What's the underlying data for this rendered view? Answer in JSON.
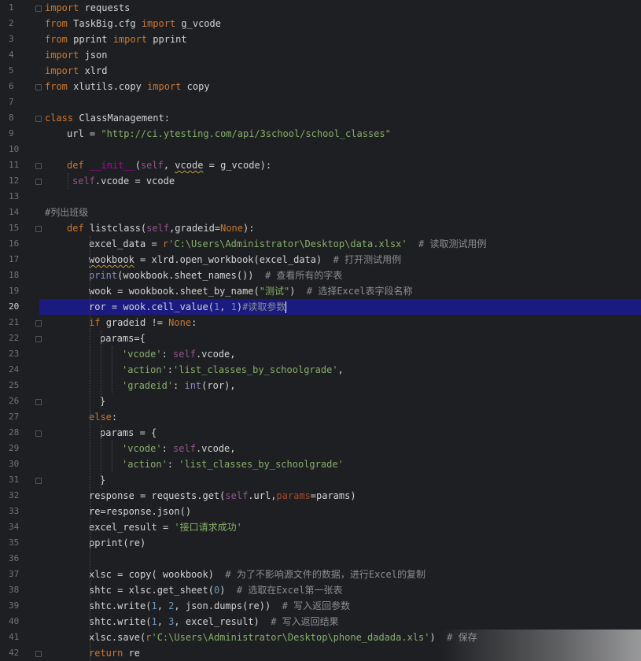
{
  "editor": {
    "active_line": 20,
    "colors": {
      "background": "#1e1f22",
      "highlight": "#1a1a80",
      "keyword": "#cc7832",
      "string": "#87b06a",
      "number": "#6897bb",
      "comment": "#8b8e92",
      "self": "#94558d"
    }
  },
  "lines": [
    {
      "n": "1",
      "indent": 0,
      "tokens": [
        [
          "kw",
          "import"
        ],
        [
          "plain",
          " requests"
        ]
      ]
    },
    {
      "n": "2",
      "indent": 0,
      "tokens": [
        [
          "kw",
          "from"
        ],
        [
          "plain",
          " TaskBig.cfg "
        ],
        [
          "kw",
          "import"
        ],
        [
          "plain",
          " g_vcode"
        ]
      ]
    },
    {
      "n": "3",
      "indent": 0,
      "tokens": [
        [
          "kw",
          "from"
        ],
        [
          "plain",
          " pprint "
        ],
        [
          "kw",
          "import"
        ],
        [
          "plain",
          " pprint"
        ]
      ]
    },
    {
      "n": "4",
      "indent": 0,
      "tokens": [
        [
          "kw",
          "import"
        ],
        [
          "plain",
          " json"
        ]
      ]
    },
    {
      "n": "5",
      "indent": 0,
      "tokens": [
        [
          "kw",
          "import"
        ],
        [
          "plain",
          " xlrd"
        ]
      ]
    },
    {
      "n": "6",
      "indent": 0,
      "tokens": [
        [
          "kw",
          "from"
        ],
        [
          "plain",
          " xlutils.copy "
        ],
        [
          "kw",
          "import"
        ],
        [
          "plain",
          " copy"
        ]
      ]
    },
    {
      "n": "7",
      "indent": 0,
      "tokens": []
    },
    {
      "n": "8",
      "indent": 0,
      "tokens": [
        [
          "kw",
          "class"
        ],
        [
          "plain",
          " ClassManagement:"
        ]
      ]
    },
    {
      "n": "9",
      "indent": 4,
      "tokens": [
        [
          "plain",
          "url = "
        ],
        [
          "str",
          "\"http://ci.ytesting.com/api/3school/school_classes\""
        ]
      ]
    },
    {
      "n": "10",
      "indent": 0,
      "tokens": []
    },
    {
      "n": "11",
      "indent": 4,
      "tokens": [
        [
          "kw",
          "def "
        ],
        [
          "magic",
          "__init__"
        ],
        [
          "plain",
          "("
        ],
        [
          "self",
          "self"
        ],
        [
          "plain",
          ", "
        ],
        [
          "sq",
          "vcode"
        ],
        [
          "plain",
          " = g_vcode):"
        ]
      ]
    },
    {
      "n": "12",
      "indent": 5,
      "tokens": [
        [
          "self",
          "self"
        ],
        [
          "plain",
          ".vcode = vcode"
        ]
      ]
    },
    {
      "n": "13",
      "indent": 0,
      "tokens": []
    },
    {
      "n": "14",
      "indent": 0,
      "tokens": [
        [
          "cmt",
          "#列出班级"
        ]
      ]
    },
    {
      "n": "15",
      "indent": 4,
      "tokens": [
        [
          "kw",
          "def "
        ],
        [
          "plain",
          "listclass("
        ],
        [
          "self",
          "self"
        ],
        [
          "plain",
          ",gradeid="
        ],
        [
          "kw",
          "None"
        ],
        [
          "plain",
          "):"
        ]
      ]
    },
    {
      "n": "16",
      "indent": 8,
      "tokens": [
        [
          "plain",
          "excel_data = "
        ],
        [
          "kw",
          "r"
        ],
        [
          "str",
          "'C:\\Users\\Administrator\\Desktop\\data.xlsx'"
        ],
        [
          "cmt",
          "  # 读取测试用例"
        ]
      ]
    },
    {
      "n": "17",
      "indent": 8,
      "tokens": [
        [
          "sq",
          "wookbook"
        ],
        [
          "plain",
          " = xlrd.open_workbook(excel_data)"
        ],
        [
          "cmt",
          "  # 打开测试用例"
        ]
      ]
    },
    {
      "n": "18",
      "indent": 8,
      "tokens": [
        [
          "builtin",
          "print"
        ],
        [
          "plain",
          "(wookbook.sheet_names())"
        ],
        [
          "cmt",
          "  # 查看所有的字表"
        ]
      ]
    },
    {
      "n": "19",
      "indent": 8,
      "tokens": [
        [
          "plain",
          "wook = wookbook.sheet_by_name("
        ],
        [
          "str",
          "\"测试\""
        ],
        [
          "plain",
          ")"
        ],
        [
          "cmt",
          "  # 选择Excel表字段名称"
        ]
      ]
    },
    {
      "n": "20",
      "indent": 8,
      "tokens": [
        [
          "plain",
          "ror = wook.cell_value("
        ],
        [
          "num",
          "1"
        ],
        [
          "plain",
          ", "
        ],
        [
          "num",
          "1"
        ],
        [
          "plain",
          ")"
        ],
        [
          "cmt",
          "#读取参数"
        ],
        [
          "caret",
          ""
        ]
      ]
    },
    {
      "n": "21",
      "indent": 8,
      "tokens": [
        [
          "kw",
          "if "
        ],
        [
          "plain",
          "gradeid != "
        ],
        [
          "kw",
          "None"
        ],
        [
          "plain",
          ":"
        ]
      ]
    },
    {
      "n": "22",
      "indent": 10,
      "tokens": [
        [
          "plain",
          "params={"
        ]
      ]
    },
    {
      "n": "23",
      "indent": 14,
      "tokens": [
        [
          "str",
          "'vcode'"
        ],
        [
          "plain",
          ": "
        ],
        [
          "self",
          "self"
        ],
        [
          "plain",
          ".vcode,"
        ]
      ]
    },
    {
      "n": "24",
      "indent": 14,
      "tokens": [
        [
          "str",
          "'action'"
        ],
        [
          "plain",
          ":"
        ],
        [
          "str",
          "'list_classes_by_schoolgrade'"
        ],
        [
          "plain",
          ","
        ]
      ]
    },
    {
      "n": "25",
      "indent": 14,
      "tokens": [
        [
          "str",
          "'gradeid'"
        ],
        [
          "plain",
          ": "
        ],
        [
          "builtin",
          "int"
        ],
        [
          "plain",
          "(ror),"
        ]
      ]
    },
    {
      "n": "26",
      "indent": 10,
      "tokens": [
        [
          "plain",
          "}"
        ]
      ]
    },
    {
      "n": "27",
      "indent": 8,
      "tokens": [
        [
          "kw",
          "else"
        ],
        [
          "plain",
          ":"
        ]
      ]
    },
    {
      "n": "28",
      "indent": 10,
      "tokens": [
        [
          "plain",
          "params = {"
        ]
      ]
    },
    {
      "n": "29",
      "indent": 14,
      "tokens": [
        [
          "str",
          "'vcode'"
        ],
        [
          "plain",
          ": "
        ],
        [
          "self",
          "self"
        ],
        [
          "plain",
          ".vcode,"
        ]
      ]
    },
    {
      "n": "30",
      "indent": 14,
      "tokens": [
        [
          "str",
          "'action'"
        ],
        [
          "plain",
          ": "
        ],
        [
          "str",
          "'list_classes_by_schoolgrade'"
        ]
      ]
    },
    {
      "n": "31",
      "indent": 10,
      "tokens": [
        [
          "plain",
          "}"
        ]
      ]
    },
    {
      "n": "32",
      "indent": 8,
      "tokens": [
        [
          "plain",
          "response = requests.get("
        ],
        [
          "self",
          "self"
        ],
        [
          "plain",
          ".url,"
        ],
        [
          "param",
          "params"
        ],
        [
          "plain",
          "=params)"
        ]
      ]
    },
    {
      "n": "33",
      "indent": 8,
      "tokens": [
        [
          "plain",
          "re=response.json()"
        ]
      ]
    },
    {
      "n": "34",
      "indent": 8,
      "tokens": [
        [
          "plain",
          "excel_result = "
        ],
        [
          "str",
          "'接口请求成功'"
        ]
      ]
    },
    {
      "n": "35",
      "indent": 8,
      "tokens": [
        [
          "plain",
          "pprint(re)"
        ]
      ]
    },
    {
      "n": "36",
      "indent": 0,
      "tokens": []
    },
    {
      "n": "37",
      "indent": 8,
      "tokens": [
        [
          "plain",
          "xlsc = copy( wookbook)"
        ],
        [
          "cmt",
          "  # 为了不影响源文件的数据，进行Excel的复制"
        ]
      ]
    },
    {
      "n": "38",
      "indent": 8,
      "tokens": [
        [
          "plain",
          "shtc = xlsc.get_sheet("
        ],
        [
          "num",
          "0"
        ],
        [
          "plain",
          ")"
        ],
        [
          "cmt",
          "  # 选取在Excel第一张表"
        ]
      ]
    },
    {
      "n": "39",
      "indent": 8,
      "tokens": [
        [
          "plain",
          "shtc.write("
        ],
        [
          "num",
          "1"
        ],
        [
          "plain",
          ", "
        ],
        [
          "num",
          "2"
        ],
        [
          "plain",
          ", json.dumps(re))"
        ],
        [
          "cmt",
          "  # 写入返回参数"
        ]
      ]
    },
    {
      "n": "40",
      "indent": 8,
      "tokens": [
        [
          "plain",
          "shtc.write("
        ],
        [
          "num",
          "1"
        ],
        [
          "plain",
          ", "
        ],
        [
          "num",
          "3"
        ],
        [
          "plain",
          ", excel_result)"
        ],
        [
          "cmt",
          "  # 写入返回结果"
        ]
      ]
    },
    {
      "n": "41",
      "indent": 8,
      "tokens": [
        [
          "plain",
          "xlsc.save("
        ],
        [
          "kw",
          "r"
        ],
        [
          "str",
          "'C:\\Users\\Administrator\\Desktop\\phone_dadada.xls'"
        ],
        [
          "plain",
          ")"
        ],
        [
          "cmt",
          "  # 保存"
        ]
      ]
    },
    {
      "n": "42",
      "indent": 8,
      "tokens": [
        [
          "kw",
          "return "
        ],
        [
          "plain",
          "re"
        ]
      ]
    }
  ]
}
